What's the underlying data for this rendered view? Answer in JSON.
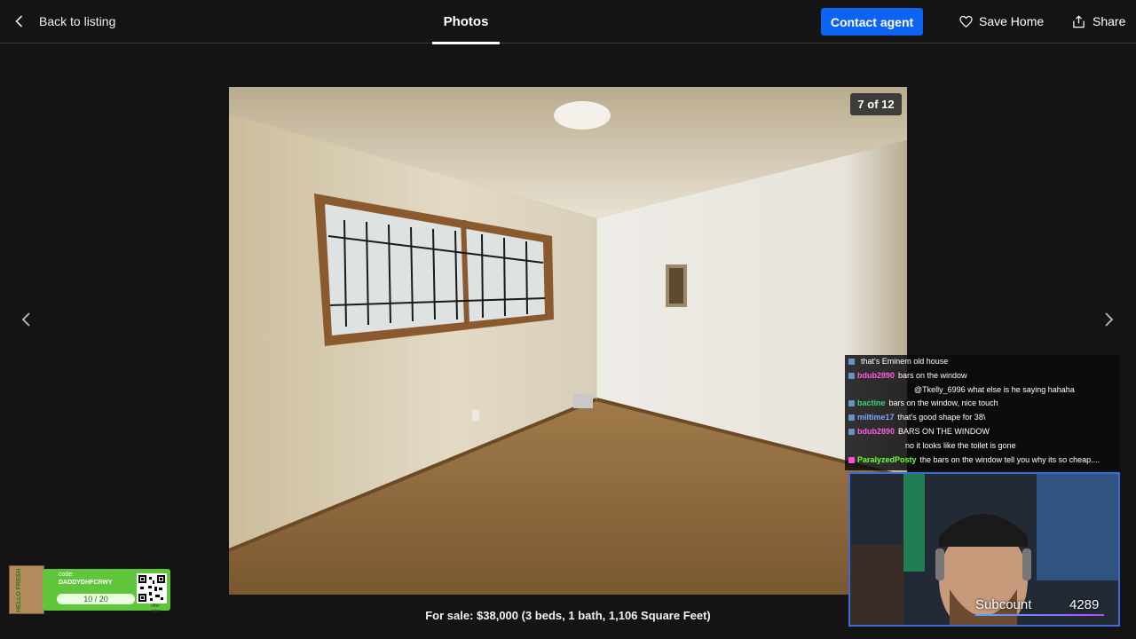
{
  "header": {
    "back_label": "Back to listing",
    "title": "Photos",
    "contact_label": "Contact agent",
    "save_label": "Save Home",
    "share_label": "Share"
  },
  "gallery": {
    "counter": "7 of 12",
    "caption": "For sale: $38,000 (3 beds, 1 bath, 1,106 Square Feet)"
  },
  "stream": {
    "chat": [
      {
        "user": "",
        "color": "#4e9cff",
        "text": "that's Eminem old house"
      },
      {
        "user": "bdub2890",
        "color": "#ff5fe0",
        "text": "bars on the window"
      },
      {
        "user": "",
        "color": "#ff3a3a",
        "text": "@Tkelly_6996 what else is he saying hahaha"
      },
      {
        "user": "bactine",
        "color": "#37d67a",
        "text": "bars on the window, nice touch"
      },
      {
        "user": "miltime17",
        "color": "#7aa7ff",
        "text": "that's good shape for 38\\"
      },
      {
        "user": "bdub2890",
        "color": "#ff5fe0",
        "text": "BARS ON THE WINDOW"
      },
      {
        "user": "",
        "color": "#b26bff",
        "text": "no it looks like the toilet is gone"
      },
      {
        "user": "ParalyzedPosty",
        "color": "#6cff3a",
        "text": "the bars on the window tell you why its so cheap...."
      }
    ],
    "sub_label": "Subcount",
    "sub_count": "4289"
  },
  "sponsor": {
    "brand": "HELLO FRESH",
    "code_label": "code:",
    "code": "DADDYDHFCRWY",
    "progress": "10 / 20",
    "progress_fraction": 0.5,
    "offer": "offer rules"
  },
  "colors": {
    "accent": "#0d63f3",
    "background": "#141414",
    "sponsor_green": "#5fc53a",
    "cam_border": "#3d6bd6"
  }
}
